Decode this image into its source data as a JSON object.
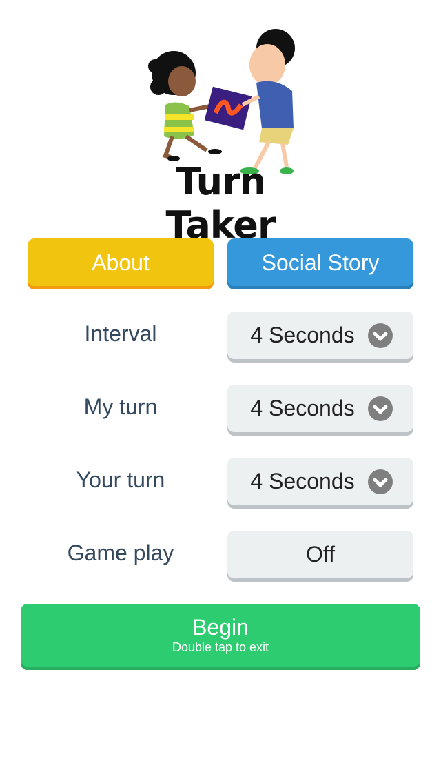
{
  "app": {
    "logo_title": "Turn Taker",
    "logo_alt": "two-children-sharing-game-illustration"
  },
  "buttons": {
    "about": "About",
    "social_story": "Social Story",
    "begin": "Begin",
    "begin_hint": "Double tap to exit"
  },
  "settings": [
    {
      "label": "Interval",
      "value": "4 Seconds",
      "icon": "chevron-down-circle-icon"
    },
    {
      "label": "My turn",
      "value": "4 Seconds",
      "icon": "chevron-down-circle-icon"
    },
    {
      "label": "Your turn",
      "value": "4 Seconds",
      "icon": "chevron-down-circle-icon"
    },
    {
      "label": "Game play",
      "value": "Off"
    }
  ],
  "colors": {
    "about": "#f1c40f",
    "social_story": "#3498db",
    "begin": "#2ecc71",
    "select_bg": "#ecf0f1",
    "label_text": "#34495e"
  }
}
